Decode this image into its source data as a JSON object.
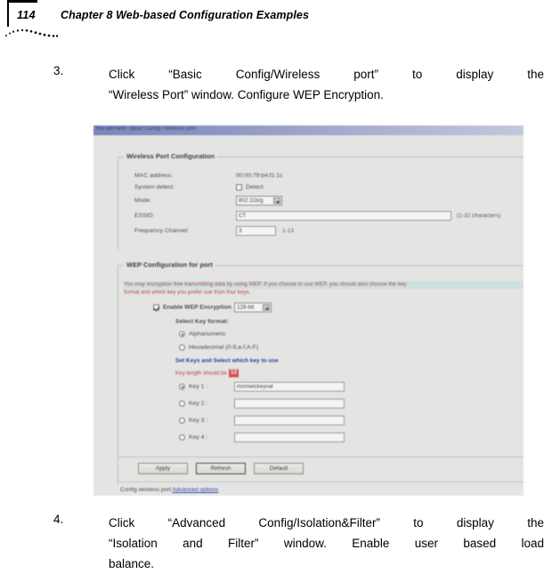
{
  "page": {
    "number": "114",
    "chapter_title": "Chapter 8 Web-based Configuration Examples"
  },
  "steps": [
    {
      "number": "3.",
      "line1": "Click “Basic Config/Wireless port” to display the",
      "line2": "“Wireless Port” window. Configure WEP Encryption."
    },
    {
      "number": "4.",
      "line1": "Click “Advanced Config/Isolation&Filter” to display the",
      "line2": "“Isolation and Filter” window. Enable user based load",
      "line3": "balance."
    }
  ],
  "screenshot": {
    "breadcrumb": "You are here : Basic Config / Wireless port",
    "wireless_port_panel": {
      "legend": "Wireless Port Configuration",
      "fields": {
        "mac_address_label": "MAC address:",
        "mac_address_value": "00:00:79:b4:f1:1c",
        "system_detect_label": "System detect:",
        "system_detect_checkbox_label": "Detect",
        "mode_label": "Mode:",
        "mode_value": "802.11b/g",
        "essid_label": "ESSID:",
        "essid_value": "CT",
        "essid_hint": "(1-32 characters)",
        "frequency_channel_label": "Frequency Channel:",
        "frequency_channel_value": "3",
        "frequency_channel_hint": "1-13"
      }
    },
    "wep_panel": {
      "legend": "WEP Configuration for port",
      "description_line1": "You may encryption free transmitting data by using WEP. If you choose to use WEP, you should also choose the key",
      "description_line2": "format and which key you prefer use from four keys.",
      "enable_wep_label": "Enable WEP Encryption",
      "enable_wep_checked": true,
      "wep_strength_value": "128-bit",
      "select_key_format_label": "Select Key format:",
      "key_format_options": [
        {
          "label": "Alphanumeric",
          "selected": true
        },
        {
          "label": "Hexadecimal (0-9,a-f,A-F)",
          "selected": false
        }
      ],
      "set_keys_label": "Set Keys and Select which key to use",
      "key_length_note": "Key length should be",
      "key_length_value": "13",
      "keys": [
        {
          "label": "Key 1 :",
          "value": "mcmwickeyval",
          "selected": true
        },
        {
          "label": "Key 2 :",
          "value": "",
          "selected": false
        },
        {
          "label": "Key 3 :",
          "value": "",
          "selected": false
        },
        {
          "label": "Key 4 :",
          "value": "",
          "selected": false
        }
      ]
    },
    "buttons": {
      "apply": "Apply",
      "refresh": "Refresh",
      "default": "Default"
    },
    "footer": {
      "text": "Config wireless port",
      "link": "Advanced options"
    }
  },
  "colors": {
    "breadcrumb_start": "#7b86c0",
    "panel_bg": "#ececeb",
    "red_text": "#b9413f",
    "link_blue": "#2b44a8",
    "highlight_cyan": "#bfe6e6"
  }
}
